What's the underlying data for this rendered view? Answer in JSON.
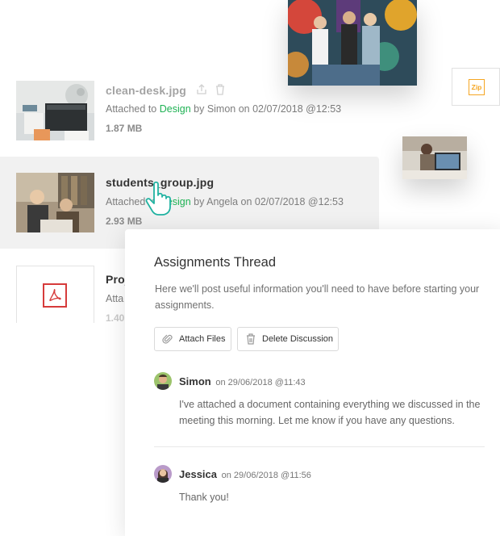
{
  "files": [
    {
      "name": "clean-desk.jpg",
      "attached_prefix": "Attached to",
      "tag": "Design",
      "attached_suffix": "by Simon on 02/07/2018 @12:53",
      "size": "1.87 MB"
    },
    {
      "name": "students_group.jpg",
      "attached_prefix": "Attached to",
      "tag": "Design",
      "attached_suffix": "by Angela on 02/07/2018 @12:53",
      "size": "2.93 MB"
    },
    {
      "name": "Proj",
      "attached_prefix": "Atta",
      "size": "1.40"
    }
  ],
  "zip_badge": "Zip",
  "thread": {
    "title": "Assignments Thread",
    "description": "Here we'll post useful information you'll need to have before starting your assignments.",
    "attach_label": "Attach Files",
    "delete_label": "Delete Discussion",
    "comments": [
      {
        "author": "Simon",
        "when": "on 29/06/2018 @11:43",
        "text": "I've attached a document containing everything we discussed in the meeting this morning. Let me know if you have any questions."
      },
      {
        "author": "Jessica",
        "when": "on 29/06/2018 @11:56",
        "text": "Thank you!"
      }
    ]
  },
  "colors": {
    "accent_green": "#1fb254",
    "zip_orange": "#f5a623",
    "pdf_red": "#d63b3b"
  }
}
